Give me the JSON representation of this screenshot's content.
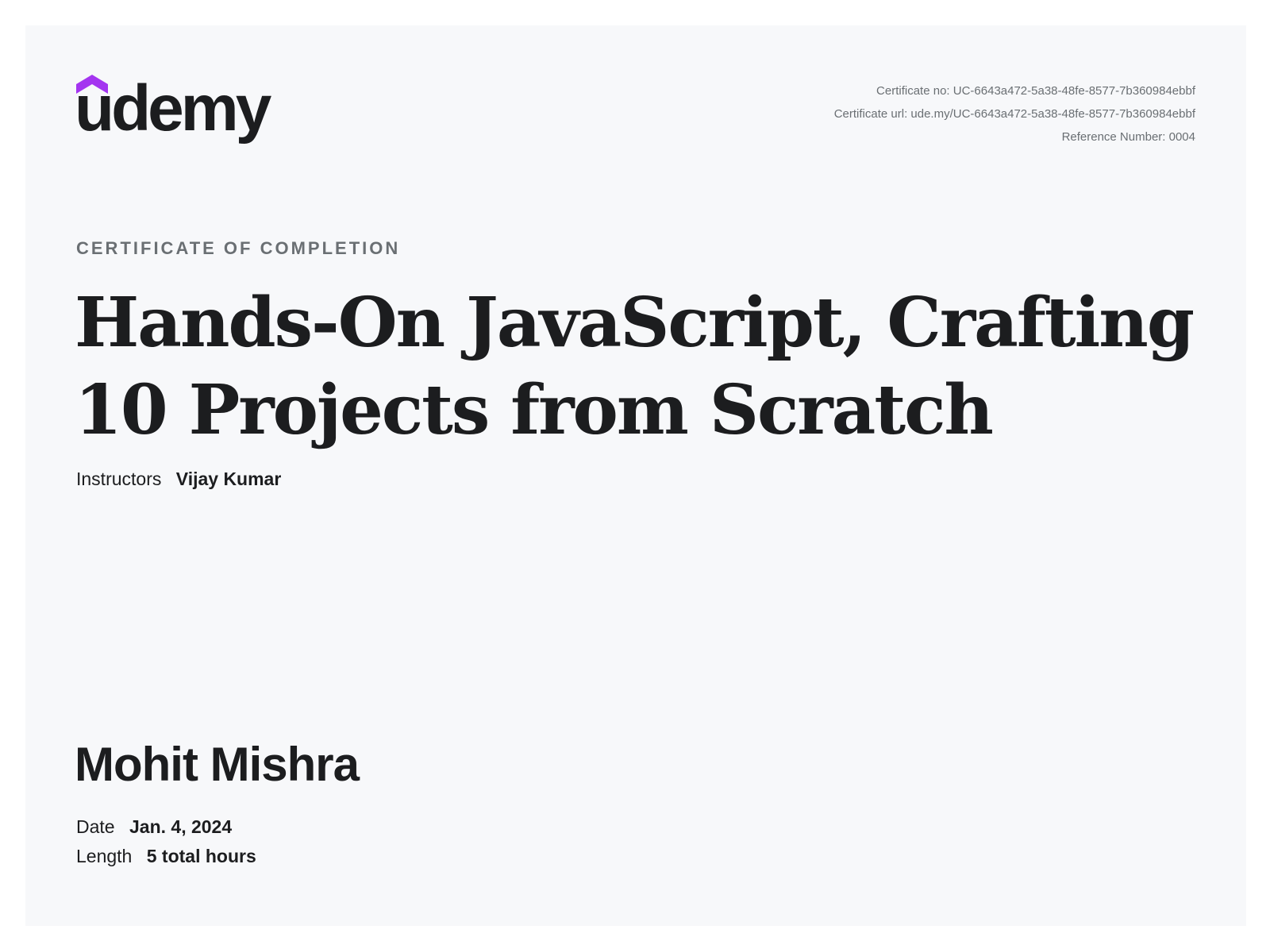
{
  "brand": {
    "logo_text": "udemy",
    "accent_color": "#a435f0"
  },
  "meta": {
    "certificate_no": "Certificate no: UC-6643a472-5a38-48fe-8577-7b360984ebbf",
    "certificate_url": "Certificate url: ude.my/UC-6643a472-5a38-48fe-8577-7b360984ebbf",
    "reference_number": "Reference Number: 0004"
  },
  "certificate": {
    "eyebrow": "CERTIFICATE OF COMPLETION",
    "course_title": "Hands-On JavaScript, Crafting 10 Projects from Scratch",
    "instructors_label": "Instructors",
    "instructors_value": "Vijay Kumar",
    "recipient_name": "Mohit Mishra",
    "date_label": "Date",
    "date_value": "Jan. 4, 2024",
    "length_label": "Length",
    "length_value": "5 total hours"
  }
}
